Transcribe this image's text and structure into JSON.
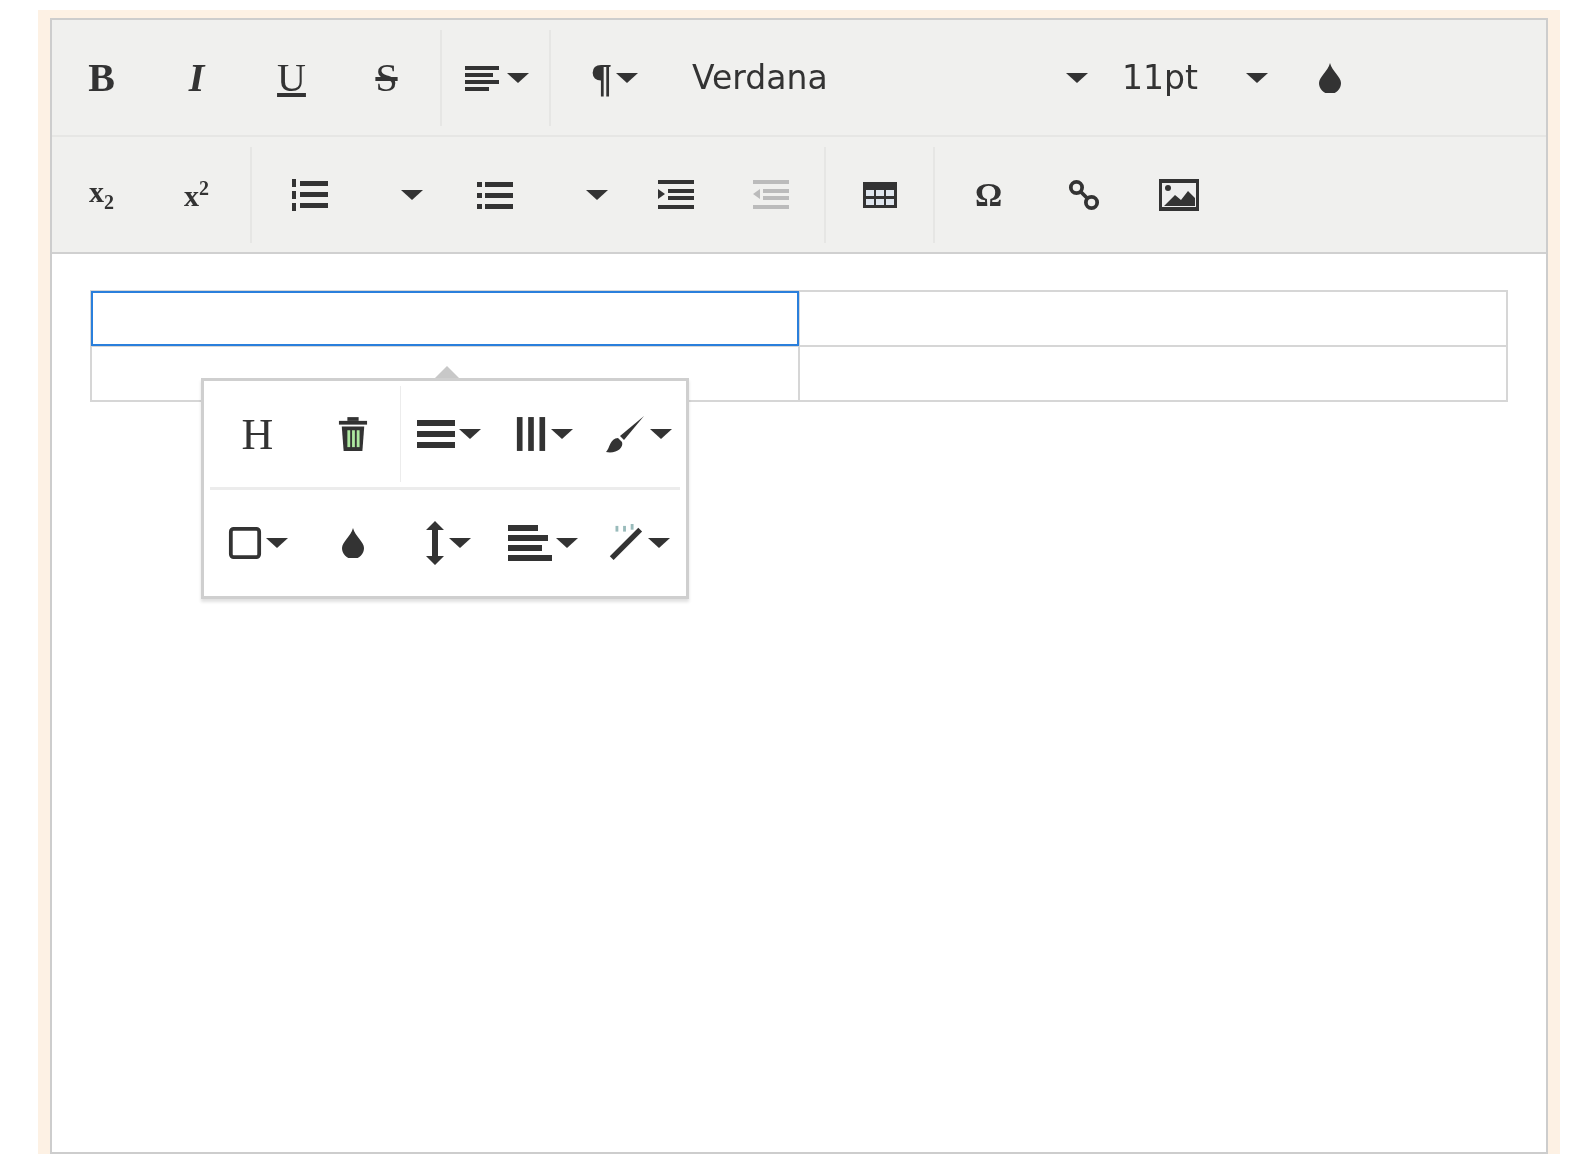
{
  "toolbar": {
    "rows": [
      {
        "groups": [
          [
            {
              "kind": "bold",
              "label": "B",
              "dropdown": false,
              "disabled": false
            },
            {
              "kind": "italic",
              "label": "I",
              "dropdown": false,
              "disabled": false
            },
            {
              "kind": "underline",
              "label": "U",
              "dropdown": false,
              "disabled": false
            },
            {
              "kind": "strikethrough",
              "label": "S",
              "dropdown": false,
              "disabled": false
            }
          ],
          [
            {
              "kind": "align",
              "dropdown": true,
              "disabled": false
            }
          ],
          [
            {
              "kind": "paragraph",
              "label": "¶",
              "dropdown": true,
              "disabled": false
            },
            {
              "kind": "font",
              "value": "Verdana",
              "dropdown": true,
              "disabled": false
            },
            {
              "kind": "size",
              "value": "11pt",
              "dropdown": true,
              "disabled": false
            },
            {
              "kind": "color",
              "dropdown": false,
              "disabled": false
            }
          ]
        ]
      },
      {
        "groups": [
          [
            {
              "kind": "subscript",
              "label": "x",
              "mark": "2",
              "dropdown": false,
              "disabled": false
            },
            {
              "kind": "superscript",
              "label": "x",
              "mark": "2",
              "dropdown": false,
              "disabled": false
            }
          ],
          [
            {
              "kind": "numlist",
              "dropdown": true,
              "disabled": false
            },
            {
              "kind": "bullist",
              "dropdown": true,
              "disabled": false
            },
            {
              "kind": "indent",
              "dropdown": false,
              "disabled": false
            },
            {
              "kind": "outdent",
              "dropdown": false,
              "disabled": true
            }
          ],
          [
            {
              "kind": "table",
              "dropdown": false,
              "disabled": false
            }
          ],
          [
            {
              "kind": "charmap",
              "label": "Ω",
              "dropdown": false,
              "disabled": false
            },
            {
              "kind": "link",
              "dropdown": false,
              "disabled": false
            },
            {
              "kind": "image",
              "dropdown": false,
              "disabled": false
            }
          ]
        ]
      }
    ]
  },
  "table": {
    "rows": [
      {
        "cells": [
          {
            "selected": true
          },
          {
            "selected": false
          }
        ]
      },
      {
        "cells": [
          {
            "selected": false
          },
          {
            "selected": false
          }
        ]
      }
    ]
  },
  "table_popup": {
    "rows": [
      {
        "groups": [
          [
            {
              "kind": "header",
              "label": "H",
              "dropdown": false,
              "disabled": false
            },
            {
              "kind": "trash",
              "dropdown": false,
              "disabled": false
            }
          ],
          [
            {
              "kind": "rows",
              "dropdown": true,
              "disabled": false
            },
            {
              "kind": "columns",
              "dropdown": true,
              "disabled": false
            },
            {
              "kind": "brush",
              "dropdown": true,
              "disabled": false
            }
          ]
        ]
      },
      {
        "groups": [
          [
            {
              "kind": "border",
              "dropdown": true,
              "disabled": false
            },
            {
              "kind": "color",
              "dropdown": false,
              "disabled": false
            },
            {
              "kind": "height",
              "dropdown": true,
              "disabled": false
            },
            {
              "kind": "valign",
              "dropdown": true,
              "disabled": false
            },
            {
              "kind": "wand",
              "dropdown": true,
              "disabled": false
            }
          ]
        ]
      }
    ]
  }
}
